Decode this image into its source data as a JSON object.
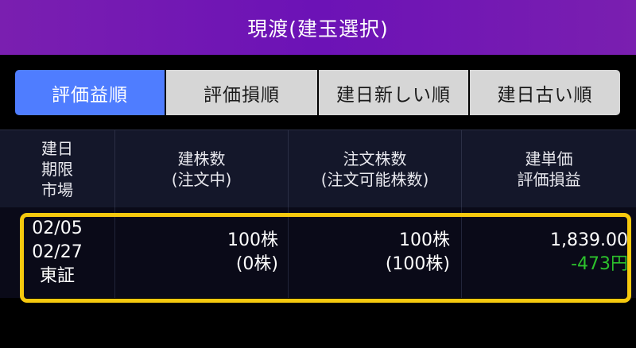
{
  "header": {
    "title": "現渡(建玉選択)"
  },
  "tabs": [
    {
      "label": "評価益順",
      "active": true
    },
    {
      "label": "評価損順",
      "active": false
    },
    {
      "label": "建日新しい順",
      "active": false
    },
    {
      "label": "建日古い順",
      "active": false
    }
  ],
  "columns": [
    {
      "lines": [
        "建日",
        "期限",
        "市場"
      ]
    },
    {
      "lines": [
        "建株数",
        "(注文中)"
      ]
    },
    {
      "lines": [
        "注文株数",
        "(注文可能株数)"
      ]
    },
    {
      "lines": [
        "建単価",
        "評価損益"
      ]
    }
  ],
  "rows": [
    {
      "open_date": "02/05",
      "expiry": "02/27",
      "market": "東証",
      "position_qty": "100株",
      "pending_qty": "(0株)",
      "order_qty": "100株",
      "available_qty": "(100株)",
      "unit_price": "1,839.00",
      "pnl": "-473円"
    }
  ],
  "colors": {
    "title_bg": "#7a1fb0",
    "tab_active": "#4f7dff",
    "tab_inactive": "#d6d6d6",
    "highlight_border": "#f6c90e",
    "pnl_text": "#2cc12c"
  }
}
